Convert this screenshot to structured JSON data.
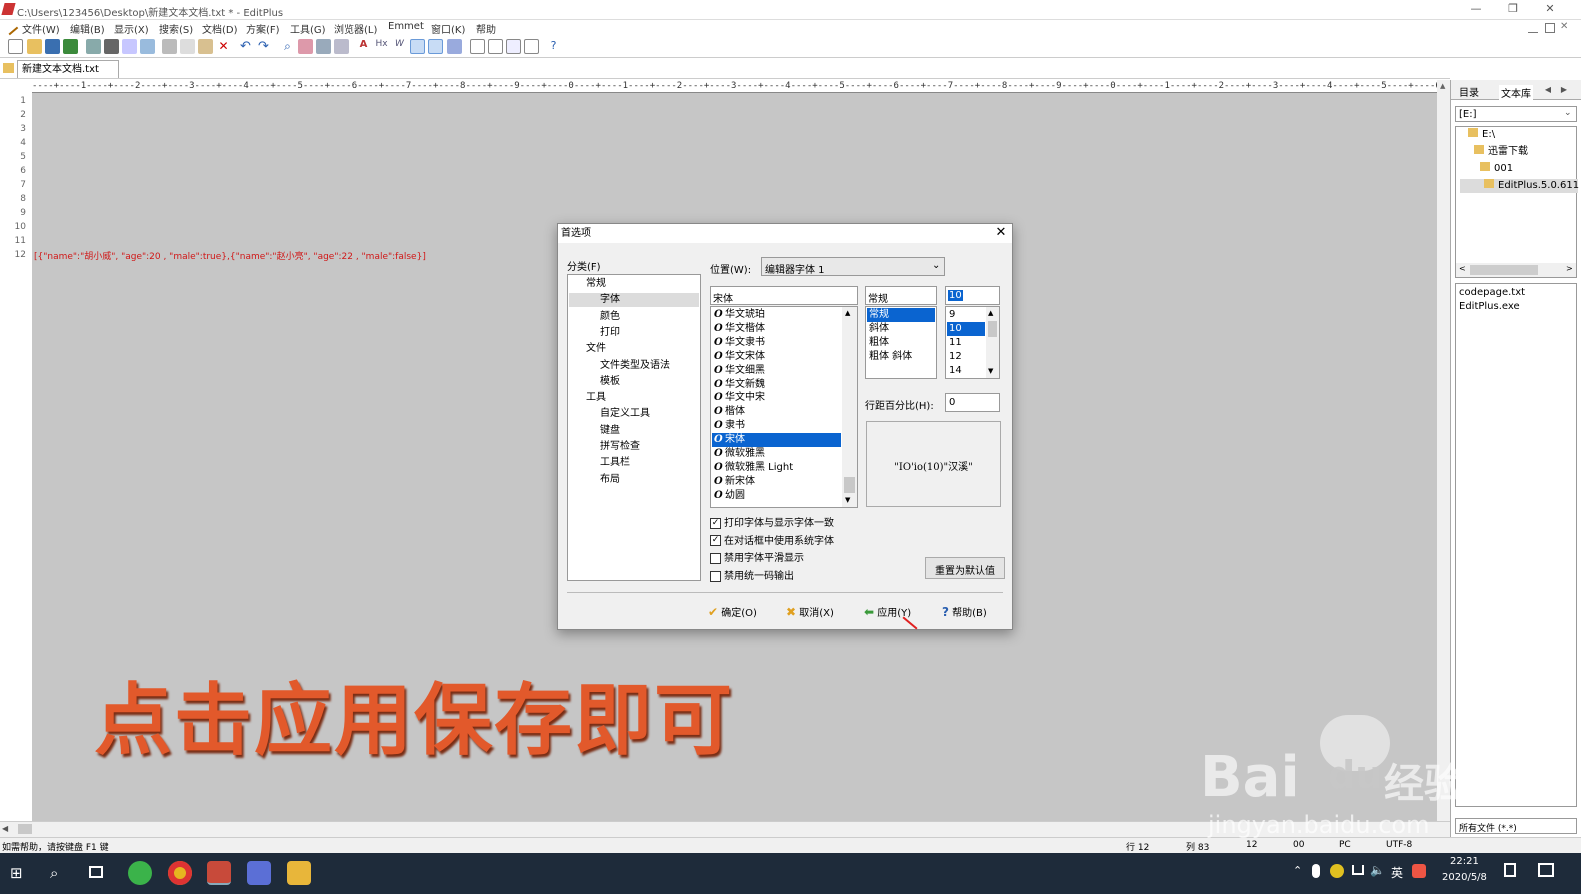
{
  "app": {
    "title": "C:\\Users\\123456\\Desktop\\新建文本文档.txt * - EditPlus",
    "window_controls": [
      "—",
      "❐",
      "✕"
    ]
  },
  "menu": [
    "文件(W)",
    "编辑(B)",
    "显示(X)",
    "搜索(S)",
    "文档(D)",
    "方案(F)",
    "工具(G)",
    "浏览器(L)",
    "Emmet",
    "窗口(K)",
    "帮助"
  ],
  "tab": {
    "label": "新建文本文档.txt"
  },
  "ruler": "----+----1----+----2----+----3----+----4----+----5----+----6----+----7----+----8----+----9----+----0----+----1----+----2----+----3----+----4----+----5----+----6----+----7----+----8----+----9----+----0----+----1----+----2----+----3----+----4----+----5----+----6----+----7----+----8----+",
  "line_numbers": [
    "1",
    "2",
    "3",
    "4",
    "5",
    "6",
    "7",
    "8",
    "9",
    "10",
    "11",
    "12"
  ],
  "code_line": "[{\"name\":\"胡小威\", \"age\":20 , \"male\":true},{\"name\":\"赵小亮\", \"age\":22 , \"male\":false}]",
  "caption": "点击应用保存即可",
  "side": {
    "tabs": [
      "目录",
      "文本库"
    ],
    "drive": "[E:]",
    "tree": [
      "E:\\",
      "迅雷下载",
      "001",
      "EditPlus.5.0.611"
    ],
    "files": [
      "codepage.txt",
      "EditPlus.exe"
    ],
    "filter": "所有文件 (*.*)"
  },
  "status": {
    "help": "如需帮助，请按键盘 F1 键",
    "line": "行 12",
    "col": "列 83",
    "c3": "12",
    "c4": "00",
    "c5": "PC",
    "encoding": "UTF-8"
  },
  "taskbar": {
    "ime": "英",
    "time": "22:21",
    "date": "2020/5/8"
  },
  "watermark": {
    "brand": "Bai",
    "du": "du",
    "jingyan": "经验",
    "url": "jingyan.baidu.com"
  },
  "dialog": {
    "title": "首选项",
    "category_label": "分类(F)",
    "categories": [
      {
        "label": "常规",
        "indent": 0
      },
      {
        "label": "字体",
        "indent": 1,
        "selected": true
      },
      {
        "label": "颜色",
        "indent": 1
      },
      {
        "label": "打印",
        "indent": 1
      },
      {
        "label": "文件",
        "indent": 0
      },
      {
        "label": "文件类型及语法",
        "indent": 1
      },
      {
        "label": "模板",
        "indent": 1
      },
      {
        "label": "工具",
        "indent": 0
      },
      {
        "label": "自定义工具",
        "indent": 1
      },
      {
        "label": "键盘",
        "indent": 1
      },
      {
        "label": "拼写检查",
        "indent": 1
      },
      {
        "label": "工具栏",
        "indent": 1
      },
      {
        "label": "布局",
        "indent": 1
      }
    ],
    "position_label": "位置(W):",
    "position_value": "编辑器字体 1",
    "font_value": "宋体",
    "fonts": [
      "华文琥珀",
      "华文楷体",
      "华文隶书",
      "华文宋体",
      "华文细黑",
      "华文新魏",
      "华文中宋",
      "楷体",
      "隶书",
      "宋体",
      "微软雅黑",
      "微软雅黑 Light",
      "新宋体",
      "幼圆"
    ],
    "font_selected": "宋体",
    "style_value": "常规",
    "styles": [
      "常规",
      "斜体",
      "粗体",
      "粗体 斜体"
    ],
    "size_value": "10",
    "sizes": [
      "9",
      "10",
      "11",
      "12",
      "14"
    ],
    "line_spacing_label": "行距百分比(H):",
    "line_spacing_value": "0",
    "preview": "\"IO'io(10)\"汉溪\"",
    "checks": [
      {
        "label": "打印字体与显示字体一致",
        "checked": true
      },
      {
        "label": "在对话框中使用系统字体",
        "checked": true
      },
      {
        "label": "禁用字体平滑显示",
        "checked": false
      },
      {
        "label": "禁用统一码输出",
        "checked": false
      }
    ],
    "reset_button": "重置为默认值",
    "buttons": {
      "ok": "确定(O)",
      "cancel": "取消(X)",
      "apply": "应用(Y)",
      "help": "帮助(B)"
    }
  },
  "colors": {
    "accent": "#0a64d0",
    "caption": "#e2592b",
    "code": "#d01818"
  }
}
